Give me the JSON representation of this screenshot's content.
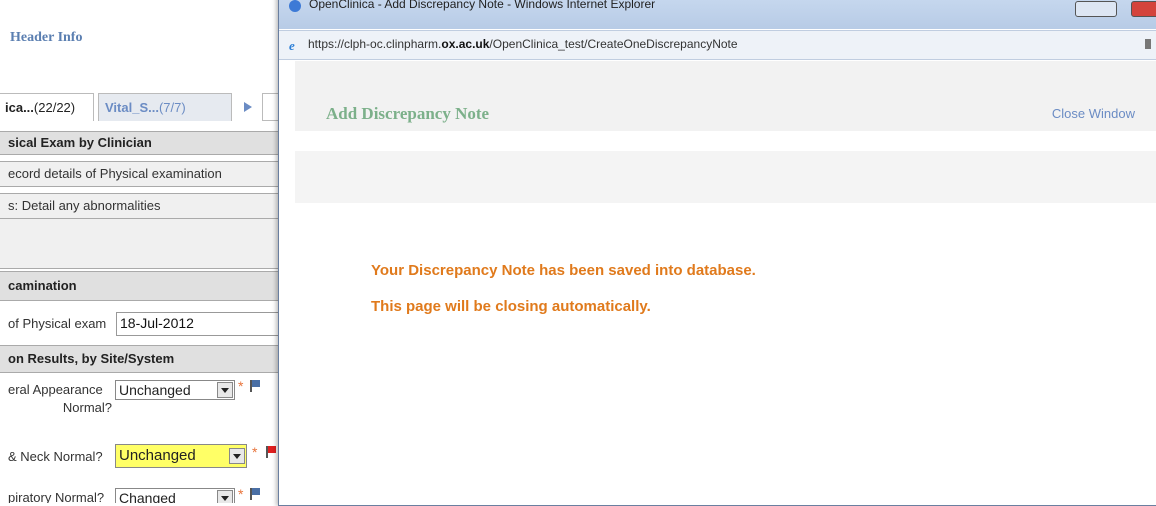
{
  "left_app": {
    "header_info": "Header Info",
    "tabs": [
      {
        "label": "ica...",
        "count": "(22/22)"
      },
      {
        "label": "Vital_S...",
        "count": "(7/7)"
      }
    ],
    "tab_more": "",
    "sections": {
      "physical_exam_title": "sical Exam by Clinician",
      "record_details": "ecord details of Physical examination",
      "detail_abnormalities": "s: Detail any abnormalities",
      "examination": "camination",
      "results_by_site": "on Results, by Site/System"
    },
    "date_field": {
      "label": "of Physical exam",
      "value": "18-Jul-2012"
    },
    "questions": [
      {
        "label_line1": "eral Appearance",
        "label_line2": "Normal?",
        "value": "Unchanged"
      },
      {
        "label_line1": "& Neck Normal?",
        "value": "Unchanged"
      },
      {
        "label_line1": "piratory Normal?",
        "value": "Changed"
      }
    ],
    "required_marker": "*"
  },
  "popup": {
    "window_title": "OpenClinica - Add Discrepancy Note - Windows Internet Explorer",
    "url_prefix": "https://clph-oc.clinpharm.",
    "url_domain": "ox.ac.uk",
    "url_path": "/OpenClinica_test/CreateOneDiscrepancyNote",
    "page_title": "Add Discrepancy Note",
    "close_window": "Close Window",
    "message_saved": "Your Discrepancy Note has been saved into database.",
    "message_closing": "This page will be closing automatically."
  }
}
